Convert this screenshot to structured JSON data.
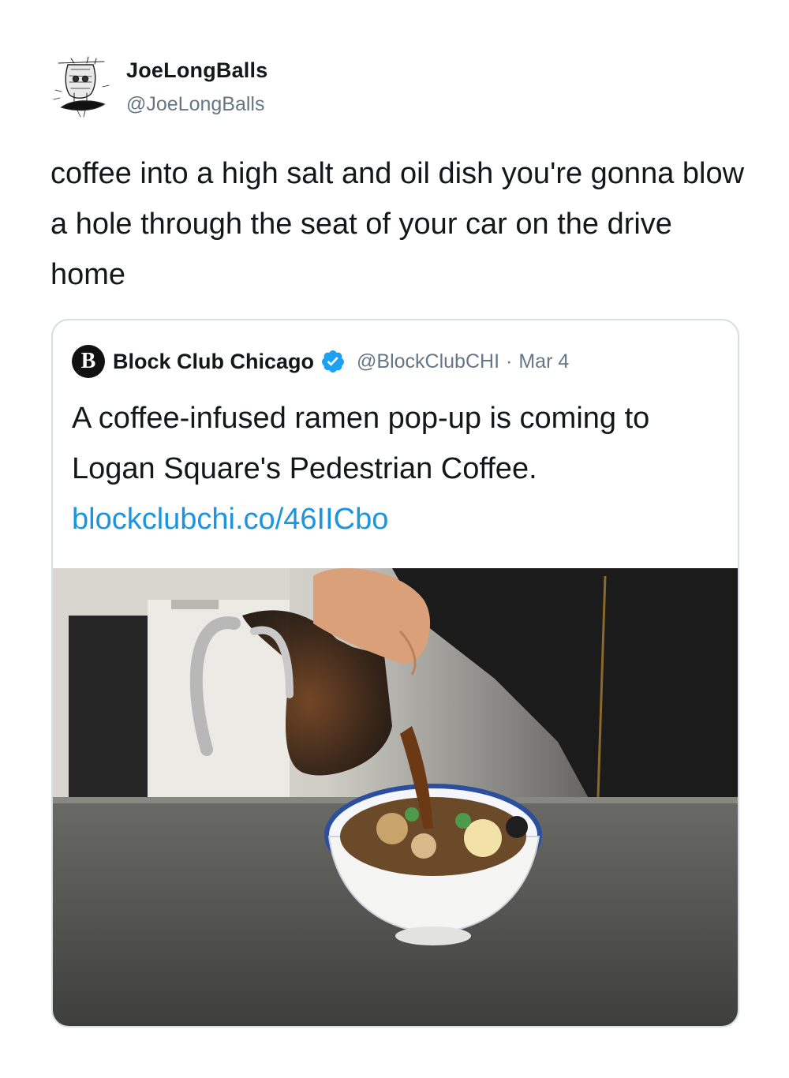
{
  "tweet": {
    "author": {
      "display_name": "JoeLongBalls",
      "handle": "@JoeLongBalls",
      "avatar_icon": "sketch-avatar-icon"
    },
    "text": "coffee into a high salt and oil dish you're gonna blow a hole through the seat of your car on the drive home"
  },
  "quoted_tweet": {
    "author": {
      "display_name": "Block Club Chicago",
      "handle": "@BlockClubCHI",
      "avatar_letter": "B",
      "verified": true
    },
    "separator": "·",
    "date": "Mar 4",
    "text": "A coffee-infused ramen pop-up is coming to Logan Square's Pedestrian Coffee.",
    "link": "blockclubchi.co/46IICbo",
    "photo_icon": "ramen-photo-icon"
  },
  "colors": {
    "text_primary": "#14171a",
    "text_secondary": "#657786",
    "link": "#1b95e0",
    "verified_badge": "#1da1f2",
    "card_border": "#d6dde3"
  }
}
